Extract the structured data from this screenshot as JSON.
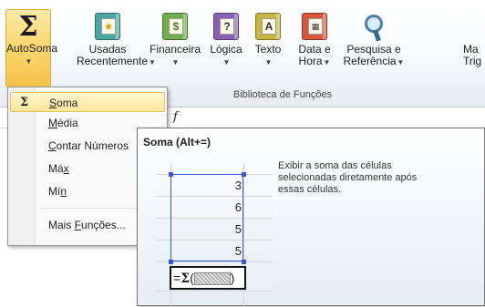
{
  "ribbon": {
    "autosoma": {
      "label": "AutoSoma",
      "icon": "sigma-icon"
    },
    "buttons": [
      {
        "line1": "Usadas",
        "line2": "Recentemente",
        "icon": "recent-functions-book-icon",
        "color": "#49a7a3"
      },
      {
        "line1": "Financeira",
        "line2": "",
        "icon": "financial-book-icon",
        "color": "#6fae4b"
      },
      {
        "line1": "Lógica",
        "line2": "",
        "icon": "logical-book-icon",
        "color": "#8b5fb3"
      },
      {
        "line1": "Texto",
        "line2": "",
        "icon": "text-book-icon",
        "color": "#c9b640"
      },
      {
        "line1": "Data e",
        "line2": "Hora",
        "icon": "date-time-book-icon",
        "color": "#d9553c"
      },
      {
        "line1": "Pesquisa e",
        "line2": "Referência",
        "icon": "lookup-reference-icon",
        "color": "#4b7fa8"
      },
      {
        "line1": "Ma",
        "line2": "Trig",
        "icon": "math-trig-icon",
        "color": "#777777"
      }
    ],
    "group_label": "Biblioteca de Funções"
  },
  "formula_bar": {
    "fx": "f"
  },
  "menu": {
    "items": [
      {
        "pre": "",
        "mn": "S",
        "post": "oma",
        "selected": true
      },
      {
        "pre": "",
        "mn": "M",
        "post": "édia"
      },
      {
        "pre": "",
        "mn": "C",
        "post": "ontar Números"
      },
      {
        "pre": "Má",
        "mn": "x",
        "post": ""
      },
      {
        "pre": "Mí",
        "mn": "n",
        "post": ""
      },
      {
        "pre": "Mais ",
        "mn": "F",
        "post": "unções..."
      }
    ]
  },
  "tooltip": {
    "title": "Soma (Alt+=)",
    "description": "Exibir a soma das células\nselecionadas diretamente após\nessas células.",
    "values": [
      "3",
      "6",
      "5",
      "5"
    ],
    "formula": {
      "prefix": "=",
      "sigma": "Σ",
      "open": "(",
      "close": ")"
    }
  }
}
